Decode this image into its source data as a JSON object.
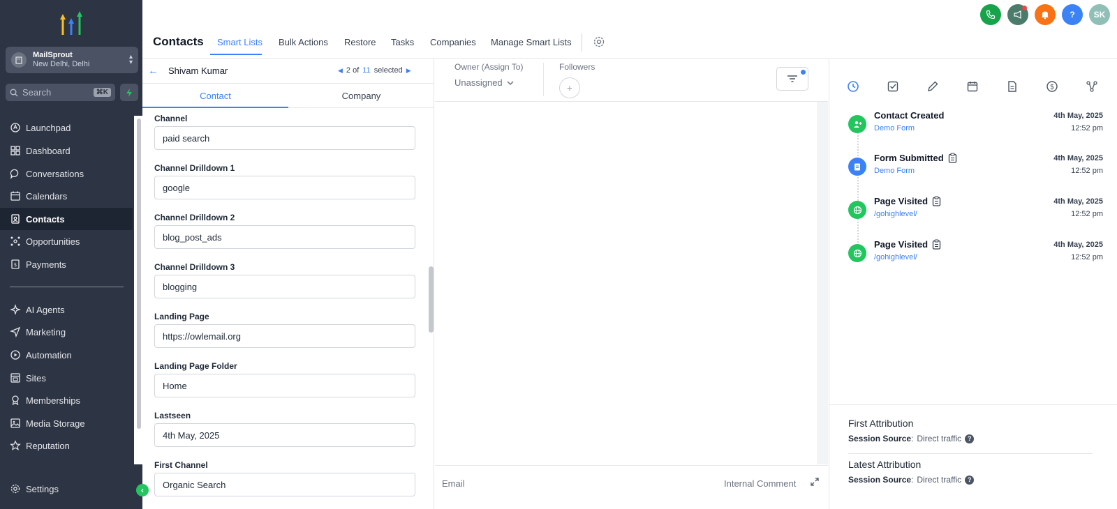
{
  "app": {
    "account": {
      "name": "MailSprout",
      "location": "New Delhi, Delhi",
      "avatar_initials": ""
    },
    "search": {
      "placeholder": "Search",
      "shortcut": "⌘K"
    },
    "brand_colors": {
      "sidebar": "#2d3443",
      "accent": "#3b82f6",
      "success": "#22c55e"
    }
  },
  "sidebar": {
    "items": [
      {
        "label": "Launchpad",
        "icon": "rocket-icon"
      },
      {
        "label": "Dashboard",
        "icon": "grid-icon"
      },
      {
        "label": "Conversations",
        "icon": "chat-icon"
      },
      {
        "label": "Calendars",
        "icon": "calendar-icon"
      },
      {
        "label": "Contacts",
        "icon": "contacts-icon",
        "active": true
      },
      {
        "label": "Opportunities",
        "icon": "network-icon"
      },
      {
        "label": "Payments",
        "icon": "receipt-icon"
      },
      {
        "label": "AI Agents",
        "icon": "sparkle-icon"
      },
      {
        "label": "Marketing",
        "icon": "send-icon"
      },
      {
        "label": "Automation",
        "icon": "automation-icon"
      },
      {
        "label": "Sites",
        "icon": "sites-icon"
      },
      {
        "label": "Memberships",
        "icon": "award-icon"
      },
      {
        "label": "Media Storage",
        "icon": "image-icon"
      },
      {
        "label": "Reputation",
        "icon": "star-icon"
      }
    ],
    "settings_label": "Settings"
  },
  "topbar": {
    "avatar_initials": "SK",
    "help_label": "?"
  },
  "header": {
    "title": "Contacts",
    "tabs": [
      "Smart Lists",
      "Bulk Actions",
      "Restore",
      "Tasks",
      "Companies",
      "Manage Smart Lists"
    ],
    "active_tab": "Smart Lists"
  },
  "contact": {
    "name": "Shivam Kumar",
    "pager": {
      "current": "2 of",
      "total": "11",
      "suffix": "selected"
    },
    "tabs": [
      "Contact",
      "Company"
    ],
    "fields": [
      {
        "label": "Channel",
        "value": "paid search"
      },
      {
        "label": "Channel Drilldown 1",
        "value": "google"
      },
      {
        "label": "Channel Drilldown 2",
        "value": "blog_post_ads"
      },
      {
        "label": "Channel Drilldown 3",
        "value": "blogging"
      },
      {
        "label": "Landing Page",
        "value": "https://owlemail.org"
      },
      {
        "label": "Landing Page Folder",
        "value": "Home"
      },
      {
        "label": "Lastseen",
        "value": "4th May, 2025"
      },
      {
        "label": "First Channel",
        "value": "Organic Search"
      }
    ]
  },
  "middle": {
    "owner_label": "Owner (Assign To)",
    "owner_value": "Unassigned",
    "followers_label": "Followers",
    "composer": {
      "email_label": "Email",
      "comment_label": "Internal Comment"
    }
  },
  "activity": {
    "items": [
      {
        "title": "Contact Created",
        "sub": "Demo Form",
        "date": "4th May, 2025",
        "time": "12:52 pm",
        "color": "#22c55e",
        "icon": "user-add-icon",
        "clip": false
      },
      {
        "title": "Form Submitted",
        "sub": "Demo Form",
        "date": "4th May, 2025",
        "time": "12:52 pm",
        "color": "#3b82f6",
        "icon": "form-icon",
        "clip": true
      },
      {
        "title": "Page Visited",
        "sub": "/gohighlevel/",
        "date": "4th May, 2025",
        "time": "12:52 pm",
        "color": "#22c55e",
        "icon": "globe-icon",
        "clip": true
      },
      {
        "title": "Page Visited",
        "sub": "/gohighlevel/",
        "date": "4th May, 2025",
        "time": "12:52 pm",
        "color": "#22c55e",
        "icon": "globe-icon",
        "clip": true
      }
    ],
    "attribution": [
      {
        "title": "First Attribution",
        "key": "Session Source",
        "value": "Direct traffic"
      },
      {
        "title": "Latest Attribution",
        "key": "Session Source",
        "value": "Direct traffic"
      }
    ]
  }
}
